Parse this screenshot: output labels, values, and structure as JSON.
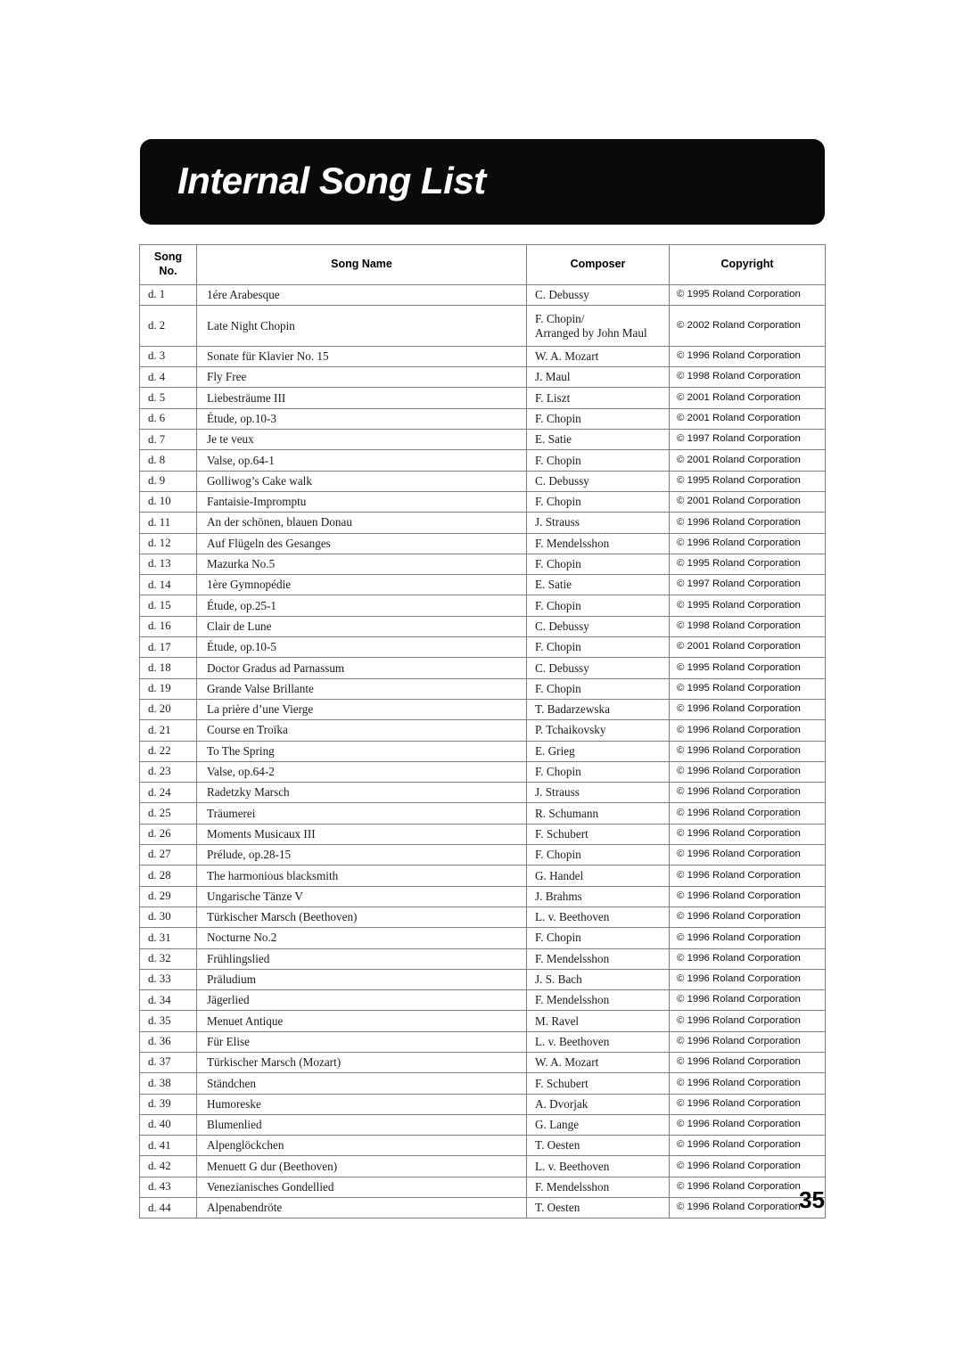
{
  "banner": {
    "title": "Internal Song List"
  },
  "table": {
    "headers": {
      "song_no_line1": "Song",
      "song_no_line2": "No.",
      "song_name": "Song Name",
      "composer": "Composer",
      "copyright": "Copyright"
    },
    "rows": [
      {
        "no": "d. 1",
        "name": "1ére Arabesque",
        "composer": "C. Debussy",
        "composer2": "",
        "copyright": "© 1995 Roland Corporation"
      },
      {
        "no": "d. 2",
        "name": "Late Night Chopin",
        "composer": "F. Chopin/",
        "composer2": "Arranged by John Maul",
        "copyright": "© 2002 Roland Corporation"
      },
      {
        "no": "d. 3",
        "name": "Sonate für Klavier No. 15",
        "composer": "W. A. Mozart",
        "composer2": "",
        "copyright": "© 1996 Roland Corporation"
      },
      {
        "no": "d. 4",
        "name": "Fly Free",
        "composer": "J. Maul",
        "composer2": "",
        "copyright": "© 1998 Roland Corporation"
      },
      {
        "no": "d. 5",
        "name": "Liebesträume III",
        "composer": "F. Liszt",
        "composer2": "",
        "copyright": "© 2001 Roland Corporation"
      },
      {
        "no": "d. 6",
        "name": "Étude, op.10-3",
        "composer": "F. Chopin",
        "composer2": "",
        "copyright": "© 2001 Roland Corporation"
      },
      {
        "no": "d. 7",
        "name": "Je te veux",
        "composer": "E. Satie",
        "composer2": "",
        "copyright": "© 1997 Roland Corporation"
      },
      {
        "no": "d. 8",
        "name": "Valse, op.64-1",
        "composer": "F. Chopin",
        "composer2": "",
        "copyright": "© 2001 Roland Corporation"
      },
      {
        "no": "d. 9",
        "name": "Golliwog’s Cake walk",
        "composer": "C. Debussy",
        "composer2": "",
        "copyright": "© 1995 Roland Corporation"
      },
      {
        "no": "d. 10",
        "name": "Fantaisie-Impromptu",
        "composer": "F. Chopin",
        "composer2": "",
        "copyright": "© 2001 Roland Corporation"
      },
      {
        "no": "d. 11",
        "name": "An der schönen, blauen Donau",
        "composer": "J. Strauss",
        "composer2": "",
        "copyright": "© 1996 Roland Corporation"
      },
      {
        "no": "d. 12",
        "name": "Auf Flügeln des Gesanges",
        "composer": "F. Mendelsshon",
        "composer2": "",
        "copyright": "© 1996 Roland Corporation"
      },
      {
        "no": "d. 13",
        "name": "Mazurka No.5",
        "composer": "F. Chopin",
        "composer2": "",
        "copyright": "© 1995 Roland Corporation"
      },
      {
        "no": "d. 14",
        "name": "1ère Gymnopédie",
        "composer": "E. Satie",
        "composer2": "",
        "copyright": "© 1997 Roland Corporation"
      },
      {
        "no": "d. 15",
        "name": "Étude, op.25-1",
        "composer": "F. Chopin",
        "composer2": "",
        "copyright": "© 1995 Roland Corporation"
      },
      {
        "no": "d. 16",
        "name": "Clair de Lune",
        "composer": "C. Debussy",
        "composer2": "",
        "copyright": "© 1998 Roland Corporation"
      },
      {
        "no": "d. 17",
        "name": "Étude, op.10-5",
        "composer": "F. Chopin",
        "composer2": "",
        "copyright": "© 2001 Roland Corporation"
      },
      {
        "no": "d. 18",
        "name": "Doctor Gradus ad Parnassum",
        "composer": "C. Debussy",
        "composer2": "",
        "copyright": "© 1995 Roland Corporation"
      },
      {
        "no": "d. 19",
        "name": "Grande Valse Brillante",
        "composer": "F. Chopin",
        "composer2": "",
        "copyright": "© 1995 Roland Corporation"
      },
      {
        "no": "d. 20",
        "name": "La prière d’une Vierge",
        "composer": "T. Badarzewska",
        "composer2": "",
        "copyright": "© 1996 Roland Corporation"
      },
      {
        "no": "d. 21",
        "name": "Course en Troïka",
        "composer": "P. Tchaikovsky",
        "composer2": "",
        "copyright": "© 1996 Roland Corporation"
      },
      {
        "no": "d. 22",
        "name": "To The Spring",
        "composer": "E. Grieg",
        "composer2": "",
        "copyright": "© 1996 Roland Corporation"
      },
      {
        "no": "d. 23",
        "name": "Valse, op.64-2",
        "composer": "F. Chopin",
        "composer2": "",
        "copyright": "© 1996 Roland Corporation"
      },
      {
        "no": "d. 24",
        "name": "Radetzky Marsch",
        "composer": "J. Strauss",
        "composer2": "",
        "copyright": "© 1996 Roland Corporation"
      },
      {
        "no": "d. 25",
        "name": "Träumerei",
        "composer": "R. Schumann",
        "composer2": "",
        "copyright": "© 1996 Roland Corporation"
      },
      {
        "no": "d. 26",
        "name": "Moments Musicaux III",
        "composer": "F. Schubert",
        "composer2": "",
        "copyright": "© 1996 Roland Corporation"
      },
      {
        "no": "d. 27",
        "name": "Prélude, op.28-15",
        "composer": "F. Chopin",
        "composer2": "",
        "copyright": "© 1996 Roland Corporation"
      },
      {
        "no": "d. 28",
        "name": "The harmonious blacksmith",
        "composer": "G. Handel",
        "composer2": "",
        "copyright": "© 1996 Roland Corporation"
      },
      {
        "no": "d. 29",
        "name": "Ungarische Tänze V",
        "composer": "J. Brahms",
        "composer2": "",
        "copyright": "© 1996 Roland Corporation"
      },
      {
        "no": "d. 30",
        "name": "Türkischer Marsch (Beethoven)",
        "composer": "L. v. Beethoven",
        "composer2": "",
        "copyright": "© 1996 Roland Corporation"
      },
      {
        "no": "d. 31",
        "name": "Nocturne No.2",
        "composer": "F. Chopin",
        "composer2": "",
        "copyright": "© 1996 Roland Corporation"
      },
      {
        "no": "d. 32",
        "name": "Frühlingslied",
        "composer": "F. Mendelsshon",
        "composer2": "",
        "copyright": "© 1996 Roland Corporation"
      },
      {
        "no": "d. 33",
        "name": "Präludium",
        "composer": "J. S. Bach",
        "composer2": "",
        "copyright": "© 1996 Roland Corporation"
      },
      {
        "no": "d. 34",
        "name": "Jägerlied",
        "composer": "F. Mendelsshon",
        "composer2": "",
        "copyright": "© 1996 Roland Corporation"
      },
      {
        "no": "d. 35",
        "name": "Menuet Antique",
        "composer": "M. Ravel",
        "composer2": "",
        "copyright": "© 1996 Roland Corporation"
      },
      {
        "no": "d. 36",
        "name": "Für Elise",
        "composer": "L. v. Beethoven",
        "composer2": "",
        "copyright": "© 1996 Roland Corporation"
      },
      {
        "no": "d. 37",
        "name": "Türkischer Marsch (Mozart)",
        "composer": "W. A. Mozart",
        "composer2": "",
        "copyright": "© 1996 Roland Corporation"
      },
      {
        "no": "d. 38",
        "name": "Ständchen",
        "composer": "F. Schubert",
        "composer2": "",
        "copyright": "© 1996 Roland Corporation"
      },
      {
        "no": "d. 39",
        "name": "Humoreske",
        "composer": "A. Dvorjak",
        "composer2": "",
        "copyright": "© 1996 Roland Corporation"
      },
      {
        "no": "d. 40",
        "name": "Blumenlied",
        "composer": "G. Lange",
        "composer2": "",
        "copyright": "© 1996 Roland Corporation"
      },
      {
        "no": "d. 41",
        "name": "Alpenglöckchen",
        "composer": "T. Oesten",
        "composer2": "",
        "copyright": "© 1996 Roland Corporation"
      },
      {
        "no": "d. 42",
        "name": "Menuett G dur (Beethoven)",
        "composer": "L. v. Beethoven",
        "composer2": "",
        "copyright": "© 1996 Roland Corporation"
      },
      {
        "no": "d. 43",
        "name": "Venezianisches Gondellied",
        "composer": "F. Mendelsshon",
        "composer2": "",
        "copyright": "© 1996 Roland Corporation"
      },
      {
        "no": "d. 44",
        "name": "Alpenabendröte",
        "composer": "T. Oesten",
        "composer2": "",
        "copyright": "© 1996 Roland Corporation"
      }
    ]
  },
  "footer": {
    "page_number": "35"
  }
}
